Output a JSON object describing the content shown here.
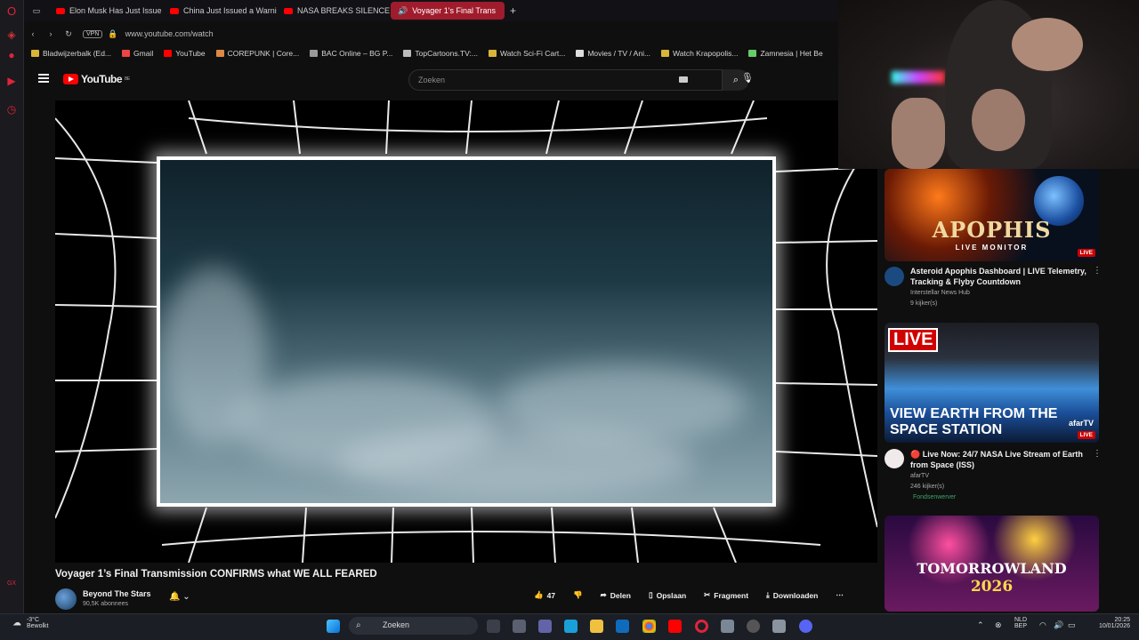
{
  "browser": {
    "tabs": [
      {
        "label": "Elon Musk Has Just Issue",
        "active": false
      },
      {
        "label": "China Just Issued a Warni",
        "active": false
      },
      {
        "label": "NASA BREAKS SILENCE o",
        "active": false
      },
      {
        "label": "Voyager 1's Final Trans",
        "active": true
      }
    ],
    "vpn_label": "VPN",
    "url": "www.youtube.com/watch",
    "bookmarks": [
      "Bladwijzerbalk (Ed...",
      "Gmail",
      "YouTube",
      "COREPUNK | Core...",
      "BAC Online – BG P...",
      "TopCartoons.TV:...",
      "Watch Sci-Fi Cart...",
      "Movies / TV / Ani...",
      "Watch Krapopolis...",
      "Zamnesia | Het Be"
    ]
  },
  "youtube": {
    "logo": "YouTube",
    "region": "BE",
    "search_placeholder": "Zoeken"
  },
  "video": {
    "title": "Voyager 1’s Final Transmission CONFIRMS what WE ALL FEARED",
    "channel": "Beyond The Stars",
    "subscribers": "90,5K abonnees",
    "likes": "47",
    "actions": {
      "share": "Delen",
      "save": "Opslaan",
      "clip": "Fragment",
      "download": "Downloaden"
    }
  },
  "recommendations": [
    {
      "thumb_text": "APOPHIS",
      "thumb_subtext": "LIVE MONITOR",
      "badge": "LIVE",
      "title": "Asteroid Apophis Dashboard | LIVE Telemetry, Tracking & Flyby Countdown",
      "channel": "Interstellar News Hub",
      "views": "9 kijker(s)"
    },
    {
      "thumb_live": "LIVE",
      "thumb_text": "VIEW EARTH FROM THE SPACE STATION",
      "thumb_brand": "afarTV",
      "badge": "LIVE",
      "title": "🔴 Live Now: 24/7 NASA Live Stream of Earth from Space (ISS)",
      "channel": "afarTV",
      "views": "246 kijker(s)",
      "tag": "Fondsenwerver"
    },
    {
      "thumb_text": "TOMORROWLAND",
      "thumb_year": "2026"
    }
  ],
  "taskbar": {
    "temp": "-3°C",
    "weather": "Bewolkt",
    "search": "Zoeken",
    "lang_1": "NLD",
    "lang_2": "BEP",
    "time": "20:25",
    "date": "10/01/2026"
  }
}
